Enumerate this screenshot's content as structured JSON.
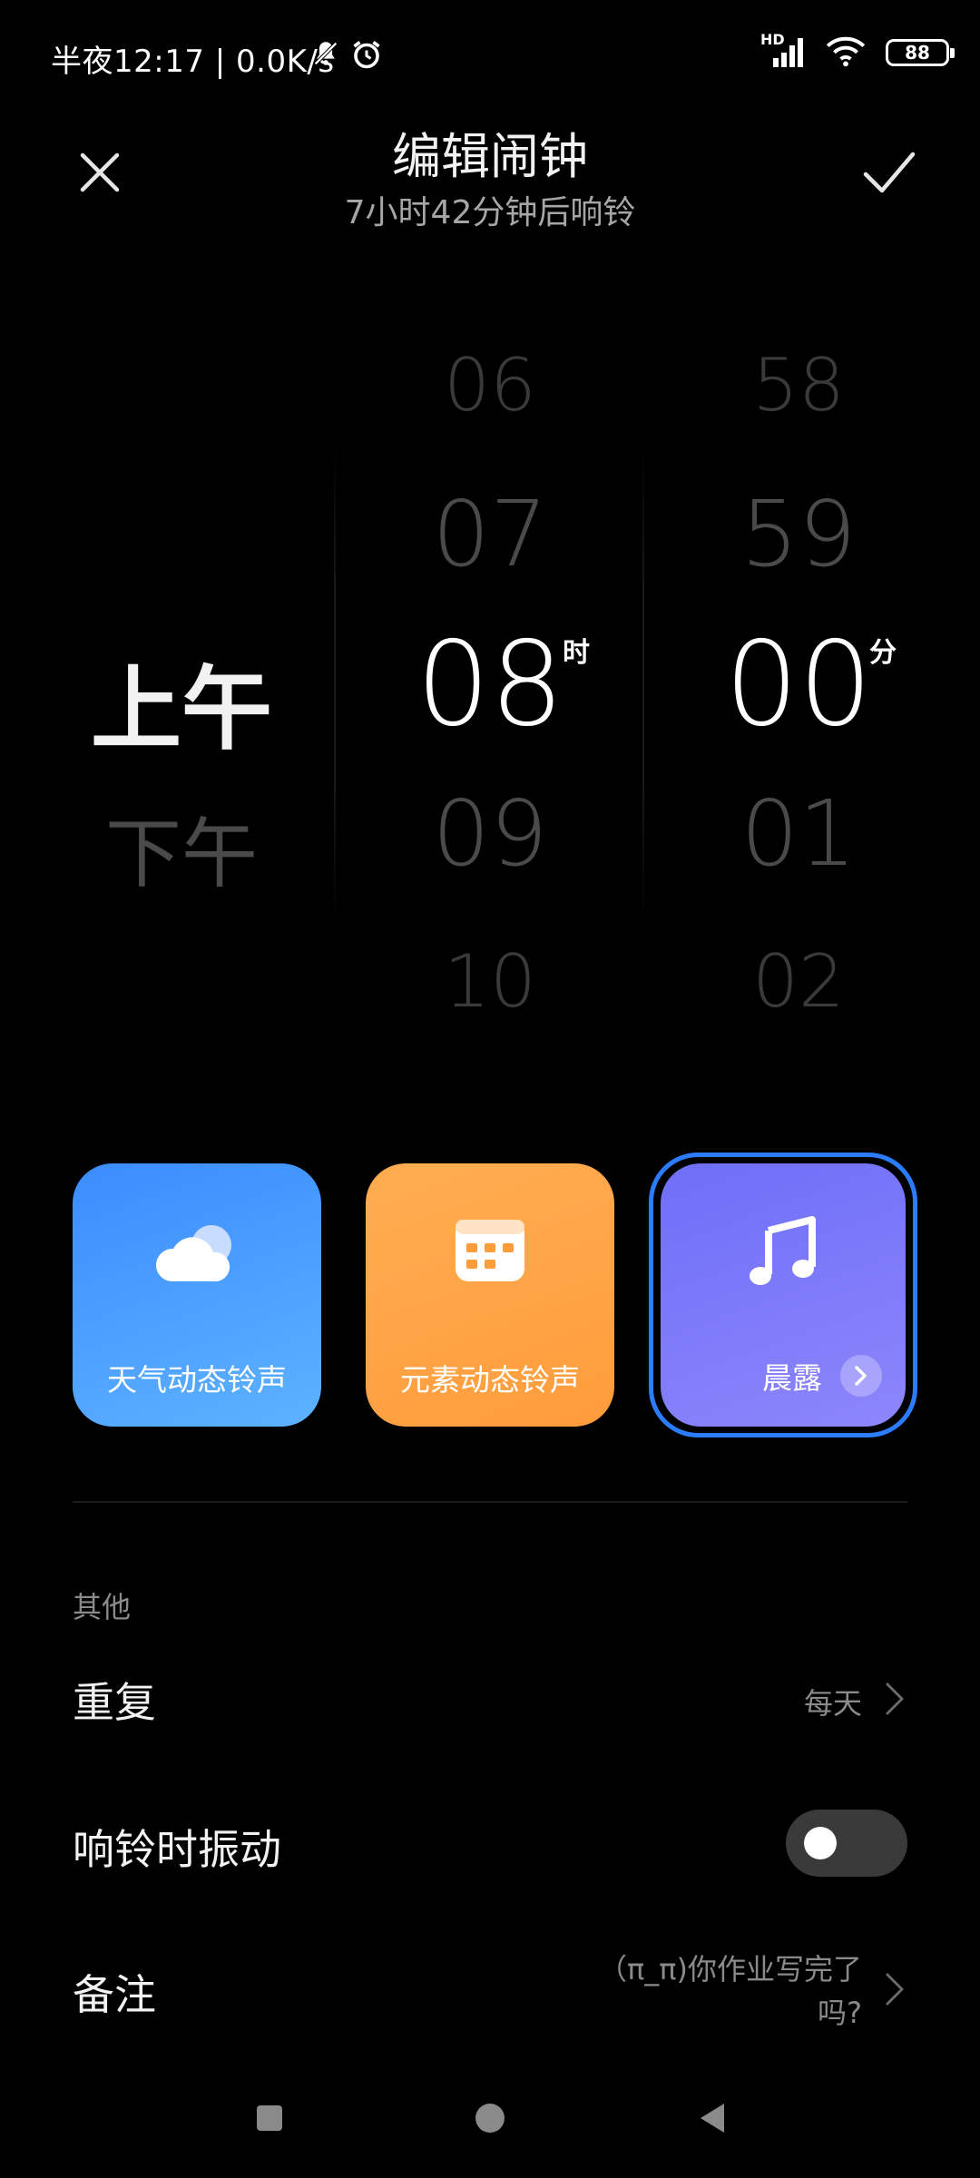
{
  "status_bar": {
    "text": "半夜12:17 | 0.0K/s",
    "battery": "88",
    "network_label": "HD"
  },
  "header": {
    "title": "编辑闹钟",
    "subtitle": "7小时42分钟后响铃"
  },
  "picker": {
    "ampm": [
      "上午",
      "下午"
    ],
    "hours": [
      "06",
      "07",
      "08",
      "09",
      "10"
    ],
    "minutes": [
      "58",
      "59",
      "00",
      "01",
      "02"
    ],
    "hour_unit": "时",
    "minute_unit": "分"
  },
  "ringtones": {
    "weather_label": "天气动态铃声",
    "element_label": "元素动态铃声",
    "music_label": "晨露"
  },
  "settings": {
    "section_label": "其他",
    "repeat_label": "重复",
    "repeat_value": "每天",
    "vibrate_label": "响铃时振动",
    "vibrate_on": false,
    "note_label": "备注",
    "note_value_line1": "（π_π)你作业写完了",
    "note_value_line2": "吗?"
  },
  "colors": {
    "accent": "#2b7cff",
    "weather_card": "#4a9dff",
    "element_card": "#ffa547",
    "music_card": "#7b78f9"
  }
}
